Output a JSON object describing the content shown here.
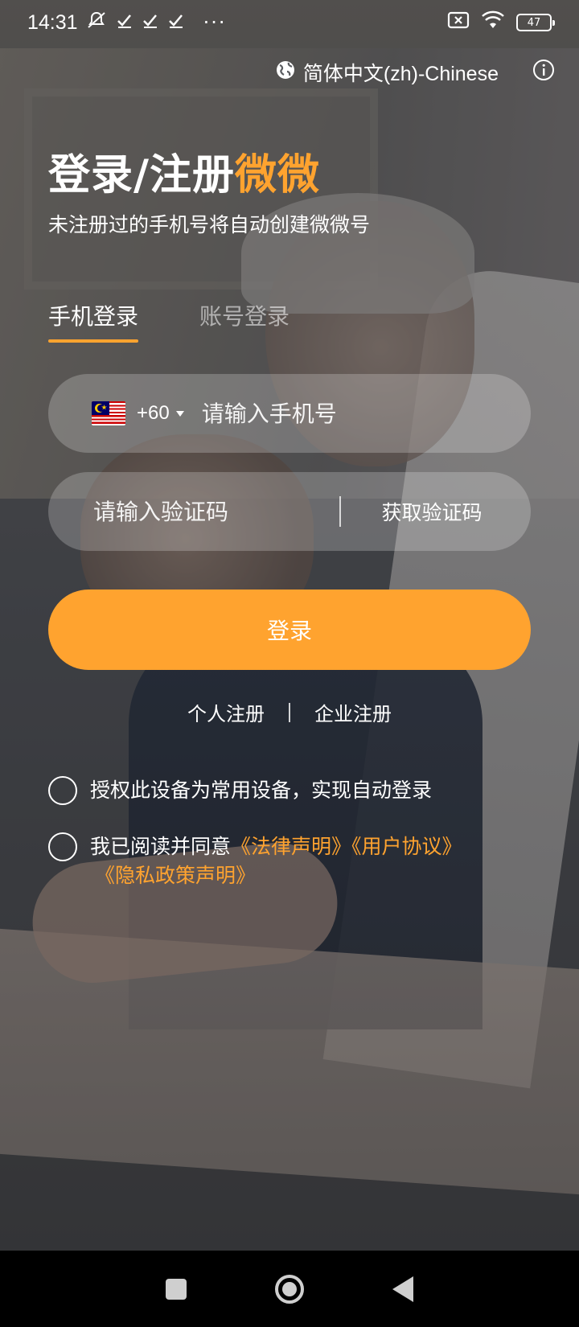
{
  "status_bar": {
    "time": "14:31",
    "battery": "47",
    "more": "···"
  },
  "header": {
    "language": "简体中文(zh)-Chinese",
    "title_main": "登录/注册",
    "title_brand": "微微",
    "subtitle": "未注册过的手机号将自动创建微微号"
  },
  "tabs": [
    {
      "label": "手机登录",
      "active": true
    },
    {
      "label": "账号登录",
      "active": false
    }
  ],
  "phone": {
    "country_code": "+60",
    "placeholder": "请输入手机号"
  },
  "verify": {
    "placeholder": "请输入验证码",
    "get_code_label": "获取验证码"
  },
  "login_button": "登录",
  "register": {
    "personal": "个人注册",
    "enterprise": "企业注册"
  },
  "options": {
    "trust_device": "授权此设备为常用设备，实现自动登录",
    "agree_prefix": "我已阅读并同意",
    "legal": "《法律声明》",
    "user_agreement": "《用户协议》",
    "privacy": "《隐私政策声明》"
  },
  "colors": {
    "accent": "#ffa32f"
  }
}
